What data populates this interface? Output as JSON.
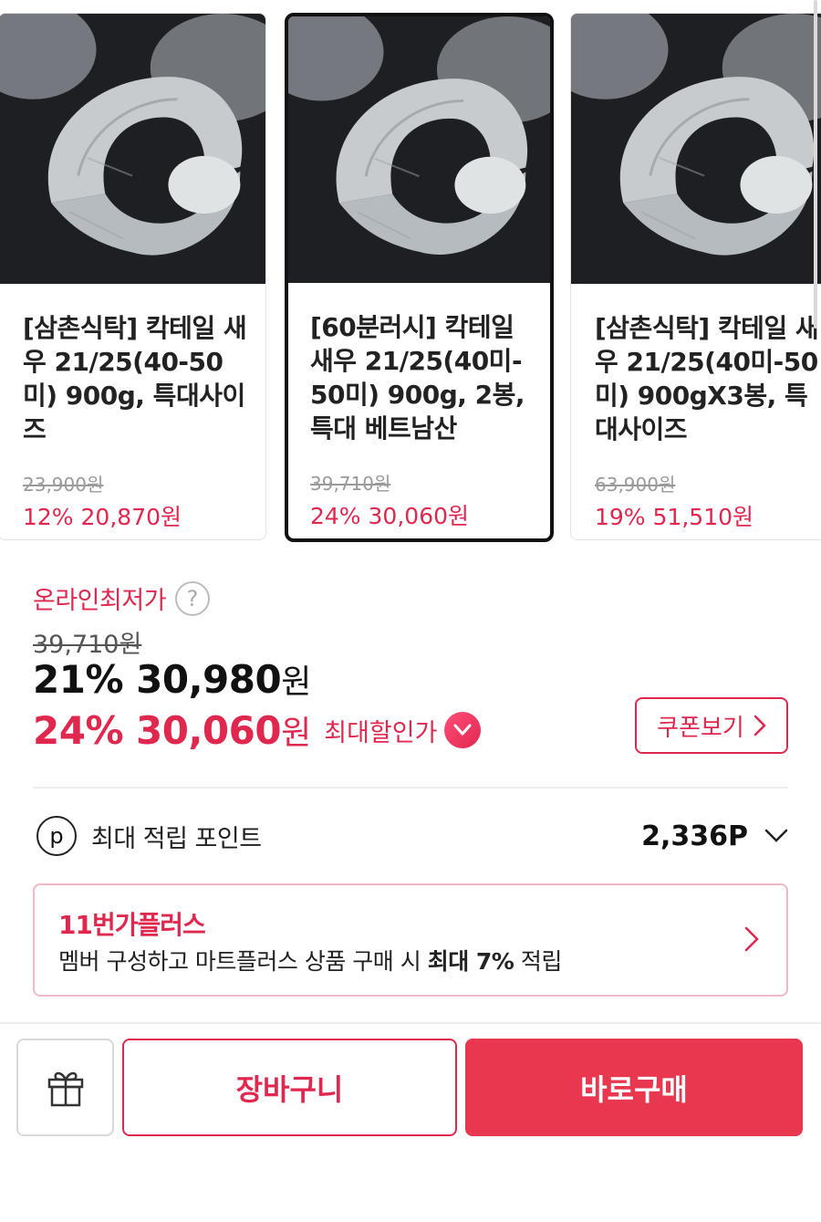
{
  "products": [
    {
      "title": "[삼촌식탁] 칵테일 새우 21/25(40-50미) 900g, 특대사이즈",
      "original_price": "23,900원",
      "discount": "12%",
      "sale_price": "20,870원",
      "image": "shrimp-photo"
    },
    {
      "title": "[60분러시] 칵테일 새우 21/25(40미-50미) 900g, 2봉, 특대 베트남산",
      "original_price": "39,710원",
      "discount": "24%",
      "sale_price": "30,060원",
      "image": "shrimp-photo",
      "selected": true
    },
    {
      "title": "[삼촌식탁] 칵테일 새우 21/25(40미-50미) 900gX3봉, 특대사이즈",
      "original_price": "63,900원",
      "discount": "19%",
      "sale_price": "51,510원",
      "image": "shrimp-photo"
    }
  ],
  "price": {
    "lowest_label": "온라인최저가",
    "help_icon": "question-icon",
    "original": "39,710원",
    "discount_pct": "21%",
    "amount": "30,980",
    "won": "원",
    "max_discount_pct": "24%",
    "max_amount": "30,060",
    "max_won": "원",
    "max_label": "최대할인가",
    "max_icon": "check-circle-icon"
  },
  "coupon": {
    "label": "쿠폰보기"
  },
  "points": {
    "label": "최대 적립 포인트",
    "value": "2,336P",
    "icon": "p-circle-icon"
  },
  "membership": {
    "brand": "11번가플러스",
    "desc_prefix": "멤버 구성하고 마트플러스 상품 구매 시",
    "desc_bold": "최대 7%",
    "desc_suffix": "적립"
  },
  "actions": {
    "gift_icon": "gift-icon",
    "cart": "장바구니",
    "buy": "바로구매"
  },
  "colors": {
    "accent": "#e0284f",
    "buy_bg": "#e8374f",
    "banner_border": "#f3b8c6"
  }
}
